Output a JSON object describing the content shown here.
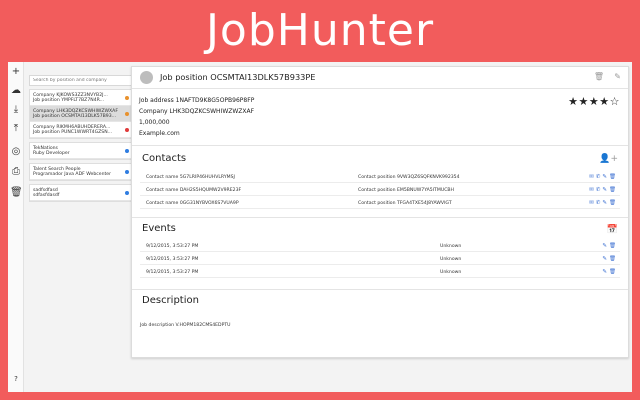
{
  "banner": {
    "title": "JobHunter"
  },
  "toolbar": {
    "buttons": [
      {
        "name": "add-icon",
        "glyph": "+"
      },
      {
        "name": "cloud-download-icon",
        "glyph": "☁"
      },
      {
        "name": "download-icon",
        "glyph": "⤓"
      },
      {
        "name": "upload-icon",
        "glyph": "⤒"
      },
      {
        "name": "chrome-icon",
        "glyph": "◎"
      },
      {
        "name": "print-icon",
        "glyph": "⎙"
      },
      {
        "name": "trash-icon",
        "glyph": "🗑"
      }
    ],
    "help": "?"
  },
  "sidebar": {
    "search_placeholder": "Search by position and company",
    "jobs": [
      {
        "line1": "Company KJKOWS3ZZ3NVYB2J...",
        "line2": "Job position YMPFLT7BZ7N4R...",
        "dot": "#e8912d"
      },
      {
        "line1": "Company LHK3DQZKCSWHIWZWXAF",
        "line2": "Job position OCSMTAI13DLK57B93...",
        "dot": "#e8912d",
        "active": true
      },
      {
        "line1": "Company RIKMH6ABUHDERERA...",
        "line2": "Job position PUNC1WWRT4GZSN...",
        "dot": "#e03b3b"
      },
      {
        "line1": "TekNations",
        "line2": "Ruby Developer",
        "dot": "#2f7de1",
        "gap": true
      },
      {
        "line1": "Talent Search People",
        "line2": "Programador Java ADF Webcenter",
        "dot": "#2f7de1",
        "gap": true
      },
      {
        "line1": "sadfsdfasd",
        "line2": "sdfasfdasdf",
        "dot": "#2f7de1",
        "gap": true
      }
    ]
  },
  "detail": {
    "title": "Job position OCSMTAI13DLK57B933PE",
    "address": "Job address 1NAFTD9K8G5OPB96P8FP",
    "company": "Company LHK3DQZKCSWHIWZWZXAF",
    "salary": "1,000,000",
    "url": "Example.com",
    "rating": 4,
    "rating_max": 5
  },
  "contacts": {
    "title": "Contacts",
    "rows": [
      {
        "name": "Contact name 5G7LRIP46HUHVLRYMSJ",
        "position": "Contact position 9VW3QZ6SQFKNVK992354"
      },
      {
        "name": "Contact name DAH2S5HQUMW2V9RE23F",
        "position": "Contact position EM5BNUW7YA5ITMUCBH"
      },
      {
        "name": "Contact name 0GG31NYBVOX6S7VUA9P",
        "position": "Contact position TFGA4TXE54J8YAWVIGT"
      }
    ]
  },
  "events": {
    "title": "Events",
    "rows": [
      {
        "date": "9/12/2015, 3:53:27 PM",
        "status": "Unknown"
      },
      {
        "date": "9/12/2015, 3:53:27 PM",
        "status": "Unknown"
      },
      {
        "date": "9/12/2015, 3:53:27 PM",
        "status": "Unknown"
      }
    ]
  },
  "description": {
    "title": "Description",
    "text": "Job description V.HOPM182CMS4EDPTU"
  },
  "colors": {
    "brand": "#f25c5c",
    "accent": "#3b6fd1"
  }
}
